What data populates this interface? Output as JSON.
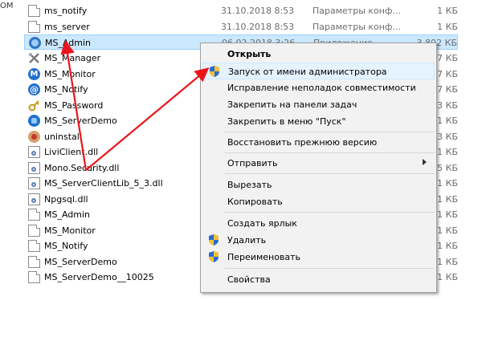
{
  "left_pane": {
    "label": "OM"
  },
  "files": [
    {
      "name": "ms_notify",
      "date": "31.10.2018 8:53",
      "type": "Параметры конф...",
      "size": "1 КБ",
      "icon": "config-file-icon"
    },
    {
      "name": "ms_server",
      "date": "31.10.2018 8:53",
      "type": "Параметры конф...",
      "size": "1 КБ",
      "icon": "config-file-icon"
    },
    {
      "name": "MS_Admin",
      "date": "06.02.2018 3:26",
      "type": "Приложение",
      "size": "3 892 КБ",
      "icon": "admin-app-icon",
      "selected": true
    },
    {
      "name": "MS_Manager",
      "date": "",
      "type": "",
      "size": "7 КБ",
      "icon": "manager-app-icon"
    },
    {
      "name": "MS_Monitor",
      "date": "",
      "type": "",
      "size": "7 КБ",
      "icon": "monitor-app-icon"
    },
    {
      "name": "MS_Notify",
      "date": "",
      "type": "",
      "size": "7 КБ",
      "icon": "notify-app-icon"
    },
    {
      "name": "MS_Password",
      "date": "",
      "type": "",
      "size": "3 КБ",
      "icon": "password-app-icon"
    },
    {
      "name": "MS_ServerDemo",
      "date": "",
      "type": "",
      "size": "1 КБ",
      "icon": "server-app-icon"
    },
    {
      "name": "uninstall",
      "date": "",
      "type": "",
      "size": "3 КБ",
      "icon": "uninstall-app-icon"
    },
    {
      "name": "LiviClient.dll",
      "date": "",
      "type": "",
      "size": "1 КБ",
      "icon": "dll-file-icon"
    },
    {
      "name": "Mono.Security.dll",
      "date": "",
      "type": "",
      "size": "5 КБ",
      "icon": "dll-file-icon"
    },
    {
      "name": "MS_ServerClientLib_5_3.dll",
      "date": "",
      "type": "",
      "size": "1 КБ",
      "icon": "dll-file-icon"
    },
    {
      "name": "Npgsql.dll",
      "date": "",
      "type": "",
      "size": "1 КБ",
      "icon": "dll-file-icon"
    },
    {
      "name": "MS_Admin",
      "date": "",
      "type": "",
      "size": "1 КБ",
      "icon": "config-file-icon"
    },
    {
      "name": "MS_Monitor",
      "date": "",
      "type": "",
      "size": "1 КБ",
      "icon": "config-file-icon"
    },
    {
      "name": "MS_Notify",
      "date": "",
      "type": "",
      "size": "1 КБ",
      "icon": "config-file-icon"
    },
    {
      "name": "MS_ServerDemo",
      "date": "",
      "type": "",
      "size": "1 КБ",
      "icon": "config-file-icon"
    },
    {
      "name": "MS_ServerDemo__10025",
      "date": "",
      "type": "",
      "size": "1 КБ",
      "icon": "config-file-icon"
    }
  ],
  "context_menu": {
    "items": [
      {
        "label": "Открыть",
        "bold": true
      },
      {
        "label": "Запуск от имени администратора",
        "icon": "uac-shield-icon",
        "highlighted": true
      },
      {
        "label": "Исправление неполадок совместимости"
      },
      {
        "label": "Закрепить на панели задач"
      },
      {
        "label": "Закрепить в меню \"Пуск\""
      },
      {
        "label": "Восстановить прежнюю версию"
      },
      {
        "label": "Отправить",
        "submenu": true
      },
      {
        "label": "Вырезать"
      },
      {
        "label": "Копировать"
      },
      {
        "label": "Создать ярлык"
      },
      {
        "label": "Удалить",
        "icon": "uac-shield-icon"
      },
      {
        "label": "Переименовать",
        "icon": "uac-shield-icon"
      },
      {
        "label": "Свойства"
      }
    ]
  },
  "colors": {
    "selection": "#cce8ff",
    "menu_background": "#f2f2f2",
    "annotation_arrow": "#e8161b"
  }
}
